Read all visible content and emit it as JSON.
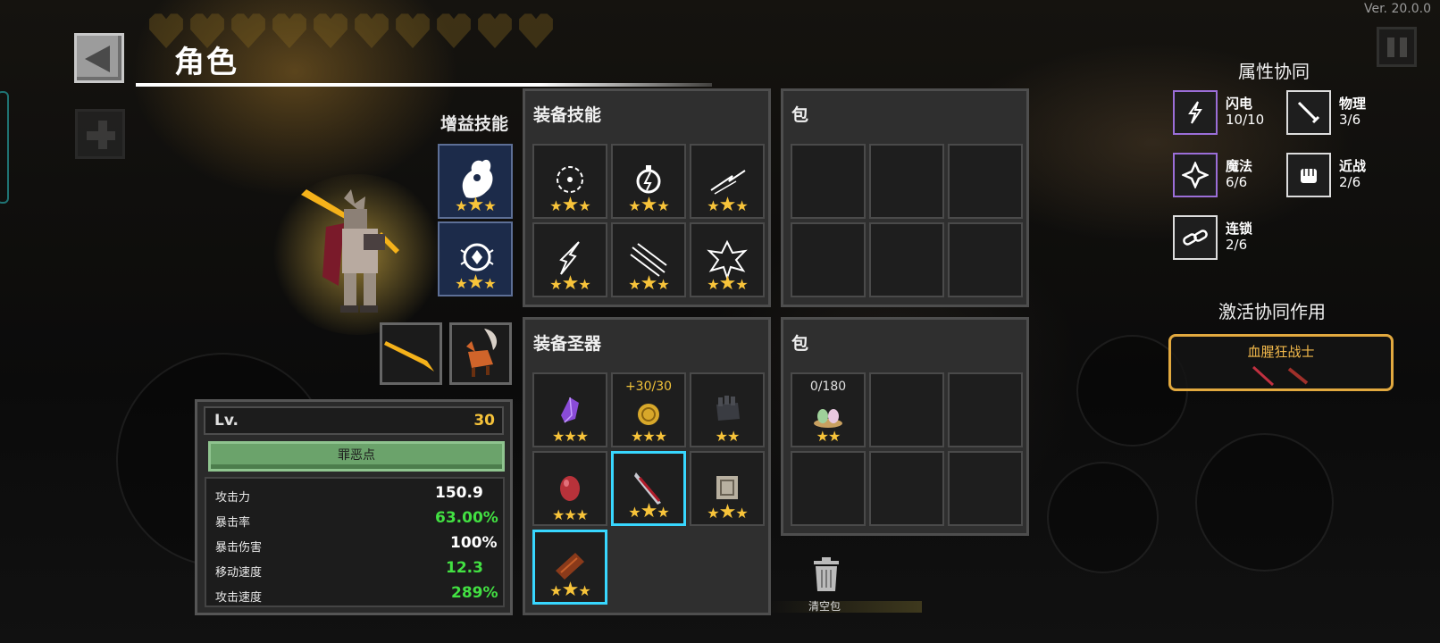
{
  "version": "Ver. 20.0.0",
  "header": {
    "title": "角色"
  },
  "buff_skills": {
    "label": "增益技能",
    "slots": [
      {
        "icon": "spirit-icon",
        "stars": 3
      },
      {
        "icon": "orb-icon",
        "stars": 3
      }
    ]
  },
  "equip_skills": {
    "title": "装备技能",
    "slots": [
      {
        "icon": "lightning-orb-icon",
        "stars": 3
      },
      {
        "icon": "lightning-bulb-icon",
        "stars": 3
      },
      {
        "icon": "lightning-streak-icon",
        "stars": 3
      },
      {
        "icon": "lightning-bolt-icon",
        "stars": 3
      },
      {
        "icon": "claw-slash-icon",
        "stars": 3
      },
      {
        "icon": "lightning-burst-icon",
        "stars": 3
      }
    ]
  },
  "bag_top": {
    "title": "包"
  },
  "equip_relics": {
    "title": "装备圣器",
    "slots": [
      {
        "icon": "crystal-icon",
        "stars": 3,
        "top": ""
      },
      {
        "icon": "coin-icon",
        "stars": 3,
        "top": "+30/30"
      },
      {
        "icon": "gauntlet-icon",
        "stars": 2,
        "top": ""
      },
      {
        "icon": "egg-icon",
        "stars": 3,
        "top": ""
      },
      {
        "icon": "blood-sword-icon",
        "stars": 3,
        "top": ""
      },
      {
        "icon": "stone-block-icon",
        "stars": 3,
        "top": ""
      },
      {
        "icon": "bracer-icon",
        "stars": 3,
        "top": ""
      }
    ]
  },
  "bag_bottom": {
    "title": "包",
    "item": {
      "icon": "egg-nest-icon",
      "count": "0/180",
      "stars": 2
    }
  },
  "stats": {
    "lv_label": "Lv.",
    "lv_value": "30",
    "sin_button": "罪恶点",
    "rows": [
      {
        "name": "攻击力",
        "value": "150.9",
        "color": "white"
      },
      {
        "name": "暴击率",
        "value": "63.00%",
        "color": "green"
      },
      {
        "name": "暴击伤害",
        "value": "100%",
        "color": "white"
      },
      {
        "name": "移动速度",
        "value": "12.3",
        "color": "green"
      },
      {
        "name": "攻击速度",
        "value": "289%",
        "color": "green"
      }
    ]
  },
  "clear_bag": "清空包",
  "synergy": {
    "title": "属性协同",
    "items": [
      {
        "name": "闪电",
        "count": "10/10",
        "icon": "lightning-icon"
      },
      {
        "name": "物理",
        "count": "3/6",
        "icon": "sword-icon"
      },
      {
        "name": "魔法",
        "count": "6/6",
        "icon": "magic-star-icon"
      },
      {
        "name": "近战",
        "count": "2/6",
        "icon": "fist-icon"
      },
      {
        "name": "连锁",
        "count": "2/6",
        "icon": "chain-icon"
      }
    ],
    "active_title": "激活协同作用",
    "active_name": "血腥狂战士"
  },
  "colors": {
    "gold": "#f5c23a",
    "green": "#42e042",
    "legend": "#38d7ff",
    "synergy_border": "#e2a93f"
  }
}
